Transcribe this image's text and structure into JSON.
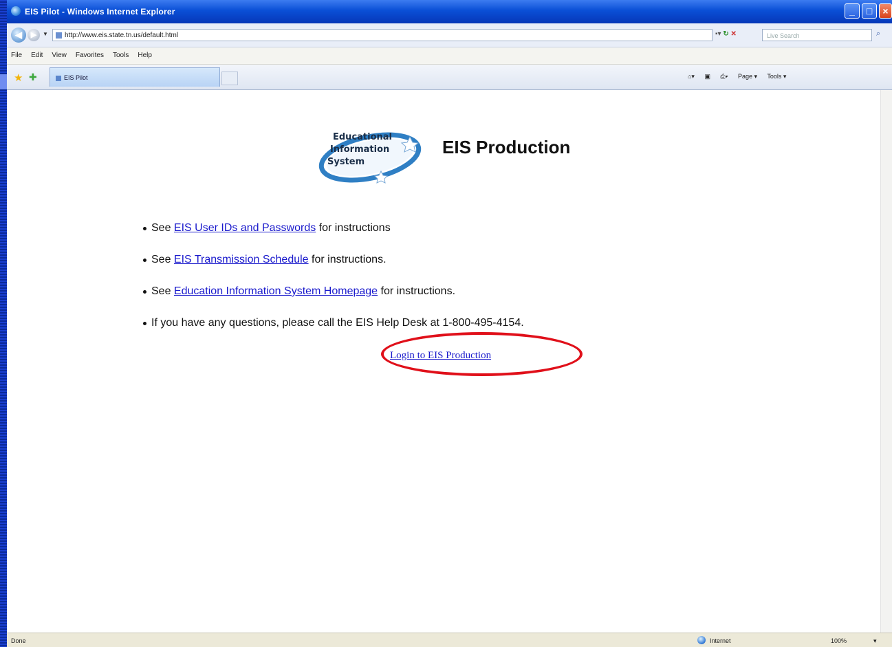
{
  "window": {
    "title": "EIS Pilot - Windows Internet Explorer",
    "minimize": "_",
    "maximize": "□",
    "close": "×"
  },
  "address": {
    "url": "http://www.eis.state.tn.us/default.html",
    "search_placeholder": "Live Search",
    "search_go": "⌕"
  },
  "menu": [
    "File",
    "Edit",
    "View",
    "Favorites",
    "Tools",
    "Help"
  ],
  "tabs": [
    {
      "label": "EIS Pilot"
    }
  ],
  "commandbar": {
    "page": "Page ▾",
    "tools": "Tools ▾"
  },
  "page": {
    "logo_lines": [
      "Educational",
      "Information",
      "System"
    ],
    "title": "EIS Production",
    "bullets": [
      {
        "prefix": "See ",
        "link": "EIS User IDs and Passwords",
        "suffix": " for instructions"
      },
      {
        "prefix": "See ",
        "link": "EIS Transmission Schedule",
        "suffix": " for instructions."
      },
      {
        "prefix": "See ",
        "link": "Education Information System Homepage",
        "suffix": " for instructions."
      },
      {
        "prefix": "",
        "link": "",
        "suffix": "If you have any questions, please call the EIS Help Desk at 1-800-495-4154."
      }
    ],
    "login_link": "Login to EIS Production"
  },
  "status": {
    "text": "Done",
    "zone": "Internet",
    "zoom": "100%"
  },
  "colors": {
    "highlight": "#e0101a",
    "link": "#1a1acc",
    "titlebar": "#0a4fd6",
    "slide_background": "#0a1f7a"
  }
}
